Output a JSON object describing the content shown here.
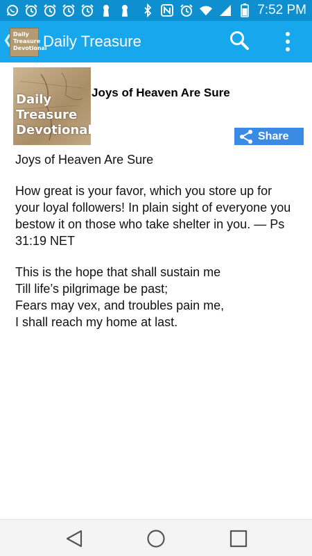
{
  "status_bar": {
    "time": "7:52 PM",
    "colors": {
      "background": "#0e8fd0"
    },
    "left_icons": [
      "whatsapp-icon",
      "alarm-icon",
      "alarm-icon",
      "alarm-icon",
      "alarm-icon",
      "keyhole-icon",
      "keyhole-icon"
    ],
    "right_icons": [
      "bluetooth-icon",
      "nfc-icon",
      "alarm-icon",
      "wifi-icon",
      "signal-icon",
      "battery-icon"
    ]
  },
  "app_bar": {
    "title": "Daily Treasure",
    "logo_text": "Daily Treasure Devotional",
    "colors": {
      "background": "#16a7ec"
    }
  },
  "entry": {
    "thumbnail_text": [
      "Daily",
      "Treasure",
      "Devotional"
    ],
    "title": "Joys of Heaven Are Sure",
    "share_label": "Share",
    "heading": "Joys of Heaven Are Sure",
    "verse": "How great is your favor, which you store up for your loyal followers! In plain sight of everyone you bestow it on those who take shelter in you. — Ps 31:19 NET",
    "poem": [
      "This is the hope that shall sustain me",
      "Till life’s pilgrimage be past;",
      "Fears may vex, and troubles pain me,",
      "I shall reach my home at last."
    ]
  },
  "colors": {
    "share_button": "#3b8be4",
    "nav_bar": "#f4f4f4"
  }
}
